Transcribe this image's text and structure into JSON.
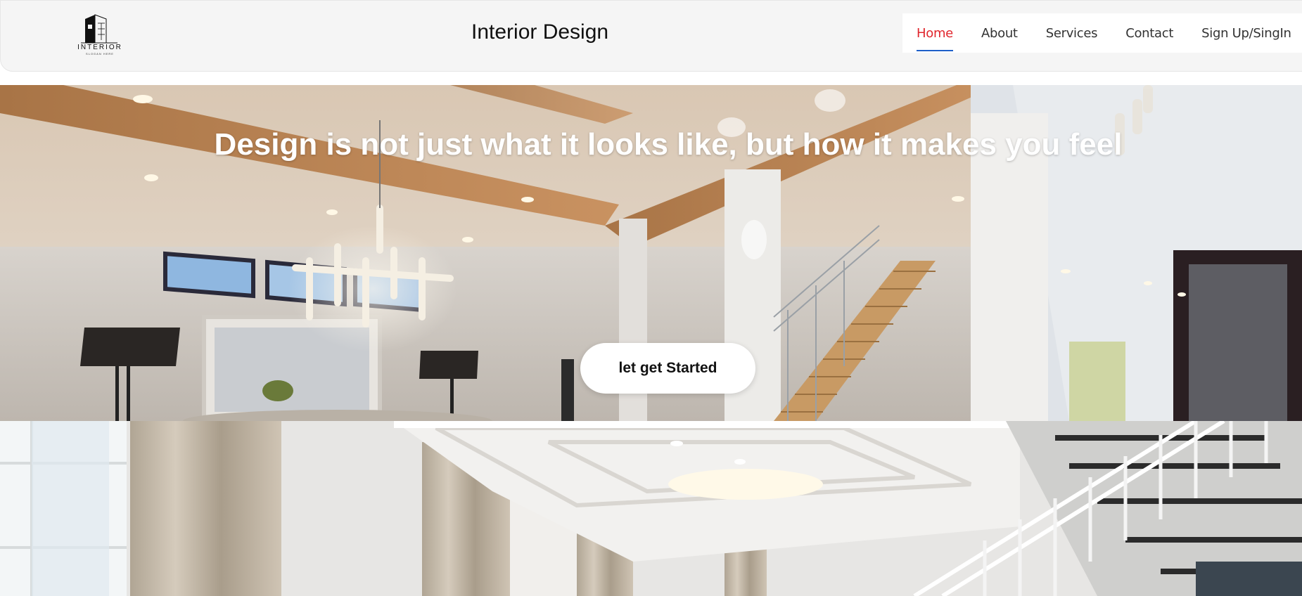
{
  "header": {
    "logo_text": "INTERIOR",
    "logo_tagline": "SLOGAN HERE",
    "title": "Interior Design",
    "nav": [
      {
        "label": "Home",
        "active": true
      },
      {
        "label": "About",
        "active": false
      },
      {
        "label": "Services",
        "active": false
      },
      {
        "label": "Contact",
        "active": false
      },
      {
        "label": "Sign Up/SingIn",
        "active": false
      }
    ],
    "more_label": "···"
  },
  "hero": {
    "quote": "Design is not just what it looks like, but how it makes you feel",
    "cta_label": "let get Started"
  },
  "colors": {
    "active_nav": "#e0262d",
    "active_underline": "#1e5fc9",
    "header_bg": "#f5f5f5"
  }
}
